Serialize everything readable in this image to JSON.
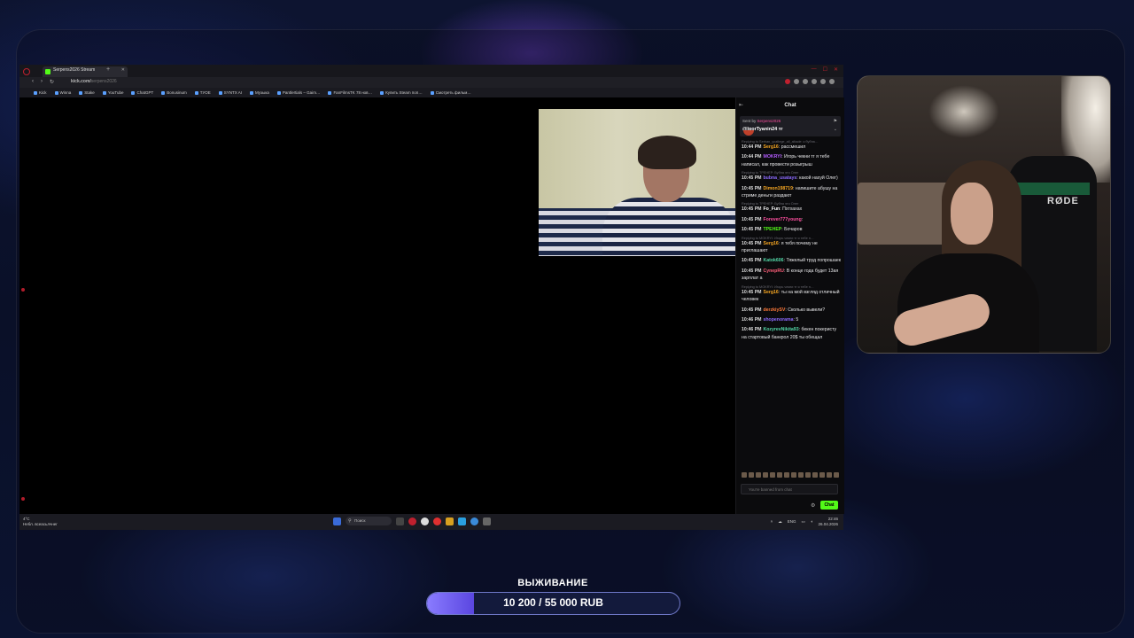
{
  "browser": {
    "tab_title": "Serpens2026 Stream",
    "url": "kick.com/",
    "url_path": "serpens2026",
    "bookmarks": [
      "Kick",
      "Winna",
      "Stake",
      "YouTube",
      "ChatGPT",
      "Bonusinum",
      "ТУОЕ",
      "SYNTX AI",
      "Музыка",
      "Pantlertials – Gaim…",
      "FanFilmsTK 78 нов…",
      "Купить Steam поп…",
      "Смотреть фильм…"
    ]
  },
  "chat": {
    "title": "Chat",
    "pinned": {
      "sent_by_label": "Sent by",
      "sent_by_user": "Serpens2026",
      "message": "@IgorTyanin24 тг"
    },
    "messages": [
      {
        "reply": "Replying to Serhan_ycatlege_all_altacle: к бубна…",
        "time": "10:44 PM",
        "user": "Serg16",
        "color": "#f5a623",
        "text": "рассмешил"
      },
      {
        "reply": "",
        "time": "10:44 PM",
        "user": "MOKRYI",
        "color": "#b45cff",
        "text": "Игорь чекни тг я тебе написал, как провести розыгрыш"
      },
      {
        "reply": "Replying to ТРЕНЕР: Бубна это Олег",
        "time": "10:45 PM",
        "user": "bubna_usatays",
        "color": "#8d6bff",
        "text": "какой нахуй Олег)"
      },
      {
        "reply": "",
        "time": "10:45 PM",
        "user": "Dimon198719",
        "color": "#f5a623",
        "text": "напишите абушу на стриме деньги раздают"
      },
      {
        "reply": "Replying to ТРЕНЕР: Бубна это Олег",
        "time": "10:45 PM",
        "user": "Fo_Fun",
        "color": "#ffffff",
        "text": "Пхтхахах"
      },
      {
        "reply": "",
        "time": "10:45 PM",
        "user": "Forever777young",
        "color": "#ff4fa0",
        "text": ""
      },
      {
        "reply": "",
        "time": "10:45 PM",
        "user": "ТРЕНЕР",
        "color": "#53fc18",
        "text": "Бочаров"
      },
      {
        "reply": "Replying to MOKRYI: Игорь чекни тг я тебе н…",
        "time": "10:45 PM",
        "user": "Serg16",
        "color": "#f5a623",
        "text": "я тебя почему не приглашают"
      },
      {
        "reply": "",
        "time": "10:45 PM",
        "user": "Katok606",
        "color": "#53d7a7",
        "text": "Тяжелый труд попрошаек"
      },
      {
        "reply": "",
        "time": "10:45 PM",
        "user": "CynepRU",
        "color": "#ff5f7a",
        "text": "В конце года будет 13ая зарплат а"
      },
      {
        "reply": "Replying to MOKRYI: Игорь чекни тг я тебе н…",
        "time": "10:45 PM",
        "user": "Serg16",
        "color": "#f5a623",
        "text": "ты на мой взгляд отличный человек"
      },
      {
        "reply": "",
        "time": "10:45 PM",
        "user": "derzkiySV",
        "color": "#ff7a3a",
        "text": "Сколько вывели?"
      },
      {
        "reply": "",
        "time": "10:46 PM",
        "user": "shopenorama",
        "color": "#8d6bff",
        "text": "5"
      },
      {
        "reply": "",
        "time": "10:46 PM",
        "user": "KozyrevNikita93",
        "color": "#53d7a7",
        "text": "бекен покеристу на стартовый банкрол 20$ ты обещал"
      }
    ],
    "banned_placeholder": "You're banned from chat",
    "chat_button": "Chat"
  },
  "taskbar": {
    "weather_temp": "4°C",
    "weather_desc": "Небл. всеасьлчнег",
    "search_placeholder": "Поиск",
    "language": "ENG",
    "time": "22:46",
    "date": "26.04.2026"
  },
  "overlay": {
    "survival_title": "ВЫЖИВАНИЕ",
    "survival_current": 10200,
    "survival_goal": 55000,
    "survival_text": "10 200 / 55 000 RUB",
    "survival_fraction": 0.1855
  },
  "colors": {
    "kick_green": "#53fc18",
    "accent_purple": "#7a64ff"
  }
}
